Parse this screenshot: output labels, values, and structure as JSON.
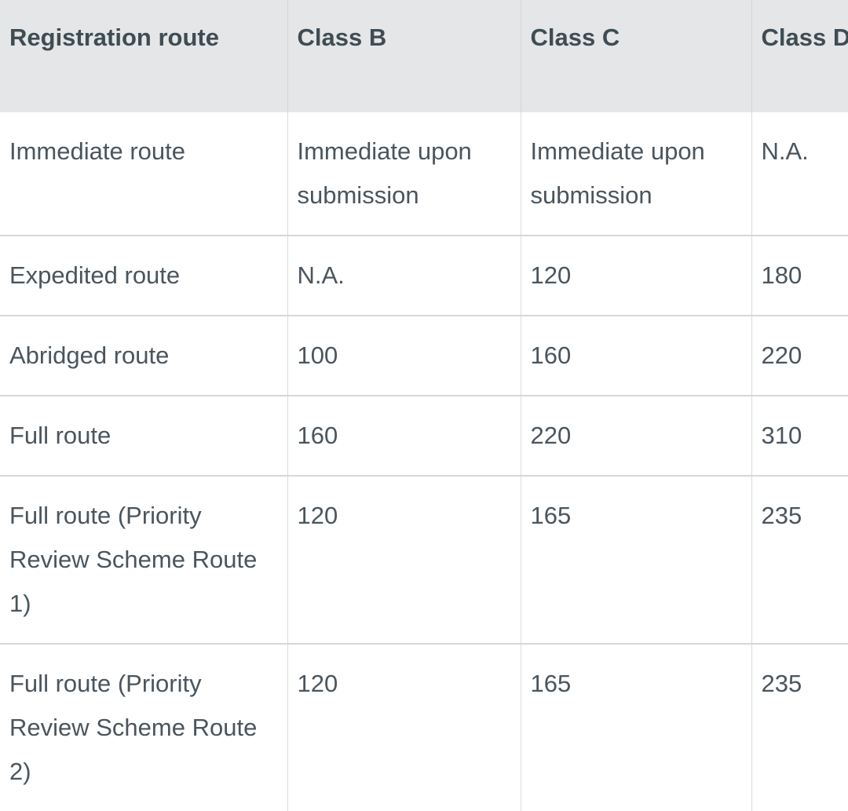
{
  "table": {
    "name": "registration-route-fees",
    "colors": {
      "header_background": "#e4e6e7",
      "header_text": "#3f4c54",
      "body_text": "#4a555e",
      "body_background": "#ffffff",
      "vertical_border": "#d8dcde",
      "horizontal_border": "#d4d8da"
    },
    "columns": [
      {
        "key": "route",
        "label": "Registration route"
      },
      {
        "key": "class_b",
        "label": "Class B"
      },
      {
        "key": "class_c",
        "label": "Class C"
      },
      {
        "key": "class_d",
        "label": "Class D"
      }
    ],
    "rows": [
      {
        "route": "Immediate route",
        "class_b": "Immediate upon submission",
        "class_c": "Immediate upon submission",
        "class_d": "N.A."
      },
      {
        "route": "Expedited route",
        "class_b": "N.A.",
        "class_c": "120",
        "class_d": "180"
      },
      {
        "route": "Abridged route",
        "class_b": "100",
        "class_c": "160",
        "class_d": "220"
      },
      {
        "route": "Full route",
        "class_b": "160",
        "class_c": "220",
        "class_d": "310"
      },
      {
        "route": "Full route (Priority Review Scheme Route 1)",
        "class_b": "120",
        "class_c": "165",
        "class_d": "235"
      },
      {
        "route": "Full route (Priority Review Scheme Route 2)",
        "class_b": "120",
        "class_c": "165",
        "class_d": "235"
      }
    ]
  }
}
